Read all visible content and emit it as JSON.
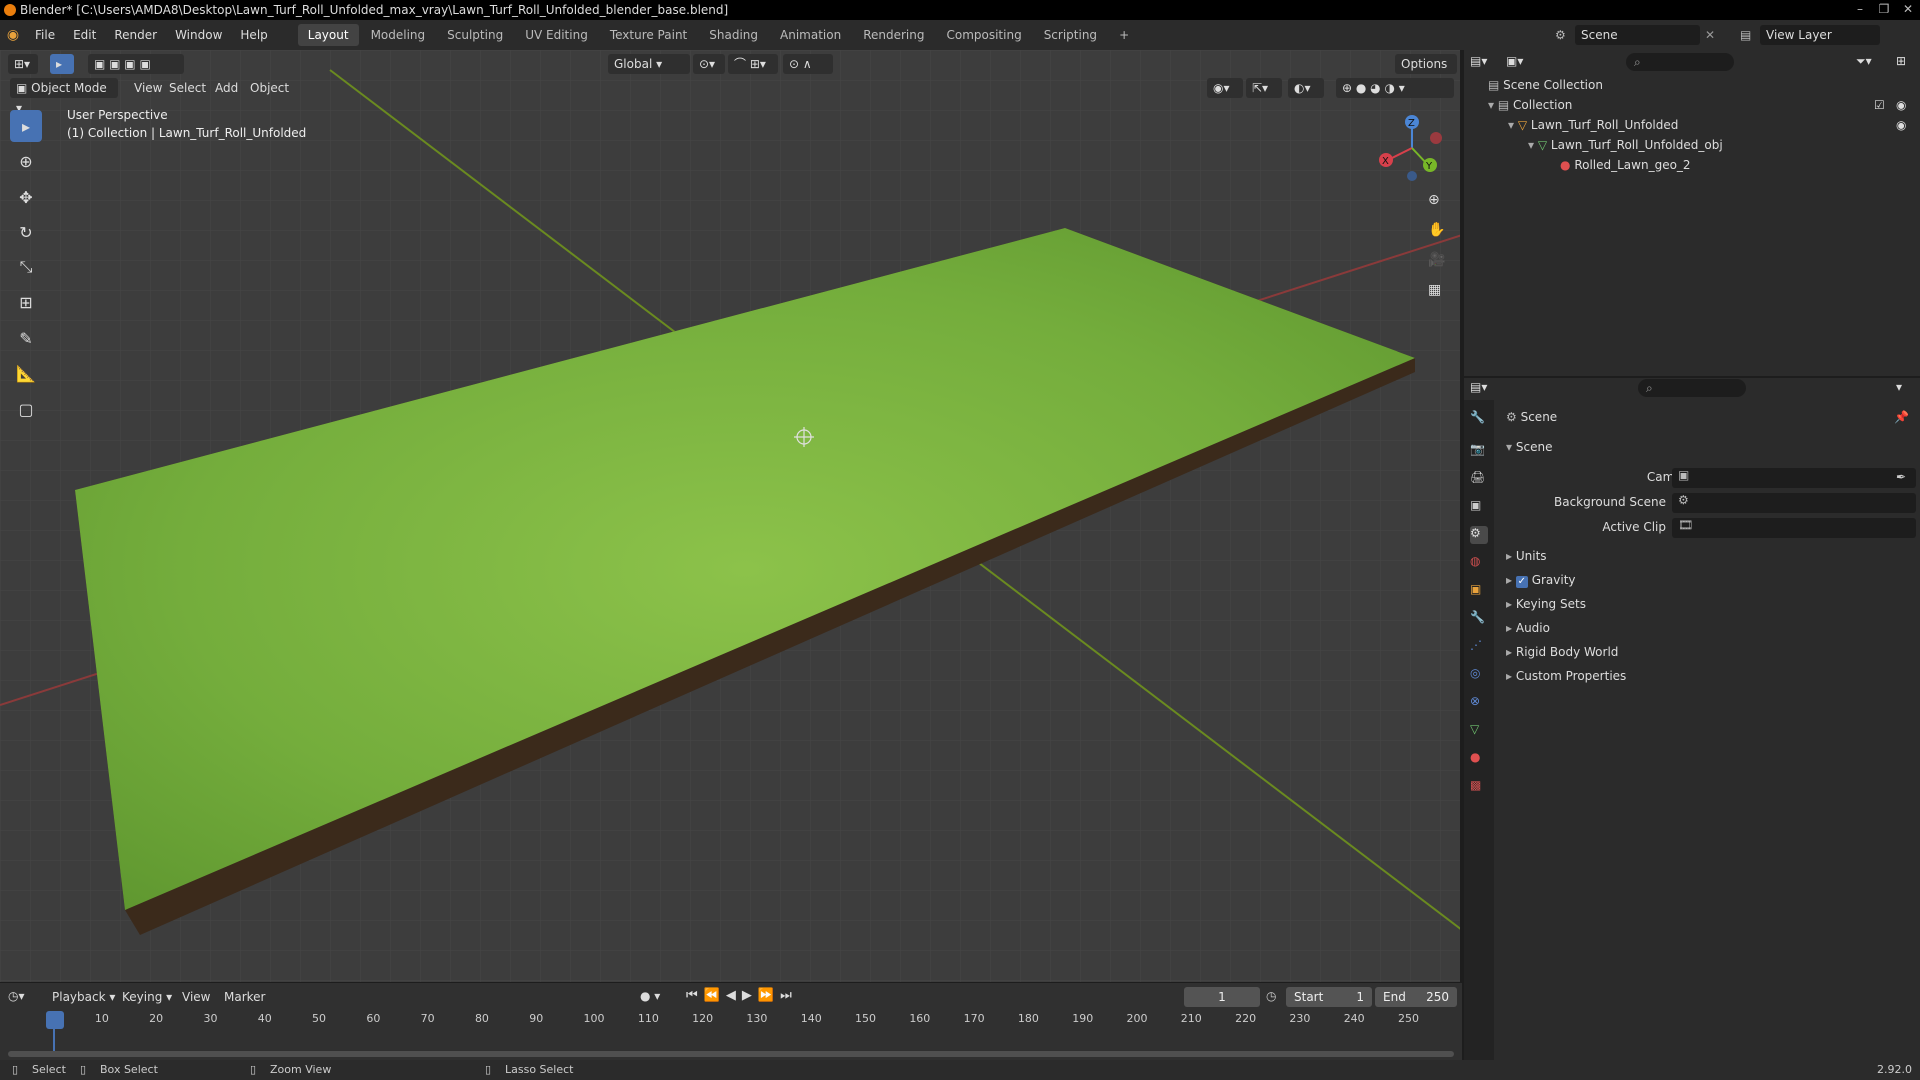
{
  "window": {
    "title": "Blender* [C:\\Users\\AMDA8\\Desktop\\Lawn_Turf_Roll_Unfolded_max_vray\\Lawn_Turf_Roll_Unfolded_blender_base.blend]",
    "controls": [
      "–",
      "❐",
      "✕"
    ]
  },
  "menu": {
    "items": [
      "File",
      "Edit",
      "Render",
      "Window",
      "Help"
    ],
    "tabs": [
      "Layout",
      "Modeling",
      "Sculpting",
      "UV Editing",
      "Texture Paint",
      "Shading",
      "Animation",
      "Rendering",
      "Compositing",
      "Scripting",
      "+"
    ],
    "active_tab": "Layout",
    "scene": "Scene",
    "view_layer": "View Layer"
  },
  "viewport": {
    "mode": "Object Mode",
    "menu": [
      "View",
      "Select",
      "Add",
      "Object"
    ],
    "transform": "Global",
    "options": "Options",
    "overlay_title": "User Perspective",
    "overlay_sub": "(1) Collection | Lawn_Turf_Roll_Unfolded",
    "gizmo": {
      "x": "X",
      "y": "Y",
      "z": "Z"
    }
  },
  "outliner": {
    "root": "Scene Collection",
    "items": [
      {
        "name": "Collection",
        "depth": 1
      },
      {
        "name": "Lawn_Turf_Roll_Unfolded",
        "depth": 2
      },
      {
        "name": "Lawn_Turf_Roll_Unfolded_obj",
        "depth": 3
      },
      {
        "name": "Rolled_Lawn_geo_2",
        "depth": 4
      }
    ]
  },
  "properties": {
    "header": "Scene",
    "section": "Scene",
    "camera_label": "Camera",
    "bg_label": "Background Scene",
    "clip_label": "Active Clip",
    "panels": [
      "Units",
      "Gravity",
      "Keying Sets",
      "Audio",
      "Rigid Body World",
      "Custom Properties"
    ],
    "gravity_checked": true
  },
  "timeline": {
    "menu": [
      "Playback",
      "Keying",
      "View",
      "Marker"
    ],
    "current": "1",
    "start_label": "Start",
    "start": "1",
    "end_label": "End",
    "end": "250",
    "ticks": [
      "1",
      "10",
      "20",
      "30",
      "40",
      "50",
      "60",
      "70",
      "80",
      "90",
      "100",
      "110",
      "120",
      "130",
      "140",
      "150",
      "160",
      "170",
      "180",
      "190",
      "200",
      "210",
      "220",
      "230",
      "240",
      "250"
    ]
  },
  "status": {
    "select": "Select",
    "box": "Box Select",
    "zoom": "Zoom View",
    "lasso": "Lasso Select",
    "version": "2.92.0"
  },
  "colors": {
    "accent": "#4772b3",
    "grass": "#7cb342",
    "soil": "#4a3522"
  }
}
